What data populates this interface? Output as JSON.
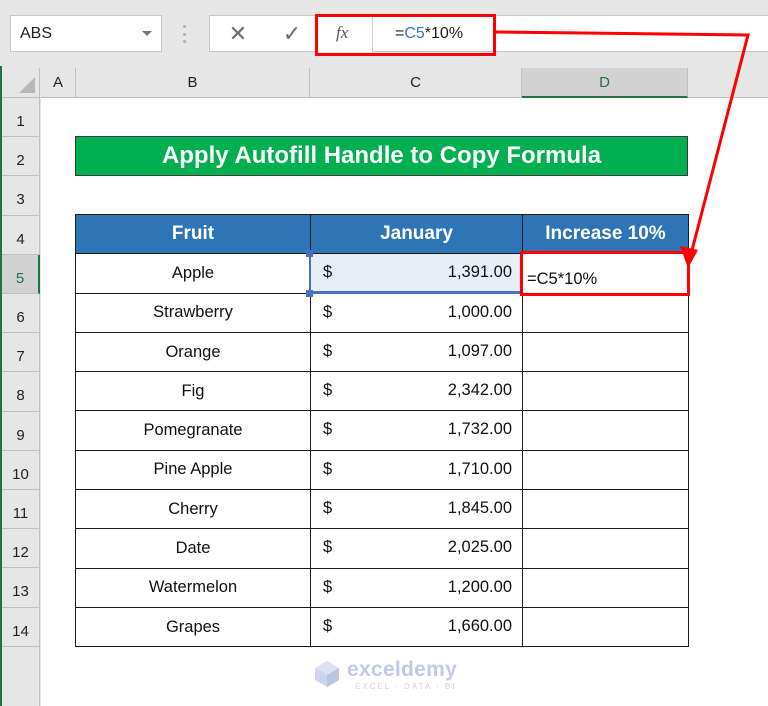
{
  "formula_bar": {
    "name_box": "ABS",
    "cancel_icon": "✕",
    "enter_icon": "✓",
    "fx_label": "fx",
    "formula_prefix": "=",
    "formula_ref": "C5",
    "formula_suffix": "*10%"
  },
  "columns": [
    "A",
    "B",
    "C",
    "D"
  ],
  "selected_column": "D",
  "rows": [
    "1",
    "2",
    "3",
    "4",
    "5",
    "6",
    "7",
    "8",
    "9",
    "10",
    "11",
    "12",
    "13",
    "14"
  ],
  "selected_row": "5",
  "title": "Apply Autofill Handle to Copy Formula",
  "table": {
    "headers": [
      "Fruit",
      "January",
      "Increase 10%"
    ],
    "currency_symbol": "$",
    "rows": [
      {
        "fruit": "Apple",
        "january": "1,391.00",
        "increase": "=C5*10%"
      },
      {
        "fruit": "Strawberry",
        "january": "1,000.00",
        "increase": ""
      },
      {
        "fruit": "Orange",
        "january": "1,097.00",
        "increase": ""
      },
      {
        "fruit": "Fig",
        "january": "2,342.00",
        "increase": ""
      },
      {
        "fruit": "Pomegranate",
        "january": "1,732.00",
        "increase": ""
      },
      {
        "fruit": "Pine Apple",
        "january": "1,710.00",
        "increase": ""
      },
      {
        "fruit": "Cherry",
        "january": "1,845.00",
        "increase": ""
      },
      {
        "fruit": "Date",
        "january": "2,025.00",
        "increase": ""
      },
      {
        "fruit": "Watermelon",
        "january": "1,200.00",
        "increase": ""
      },
      {
        "fruit": "Grapes",
        "january": "1,660.00",
        "increase": ""
      }
    ]
  },
  "watermark": {
    "name": "exceldemy",
    "tagline": "EXCEL - DATA - BI"
  },
  "colors": {
    "title_bg": "#00b050",
    "header_bg": "#2e75b6",
    "highlight": "#ff0000",
    "reference": "#4472c4",
    "excel_green": "#217346"
  }
}
